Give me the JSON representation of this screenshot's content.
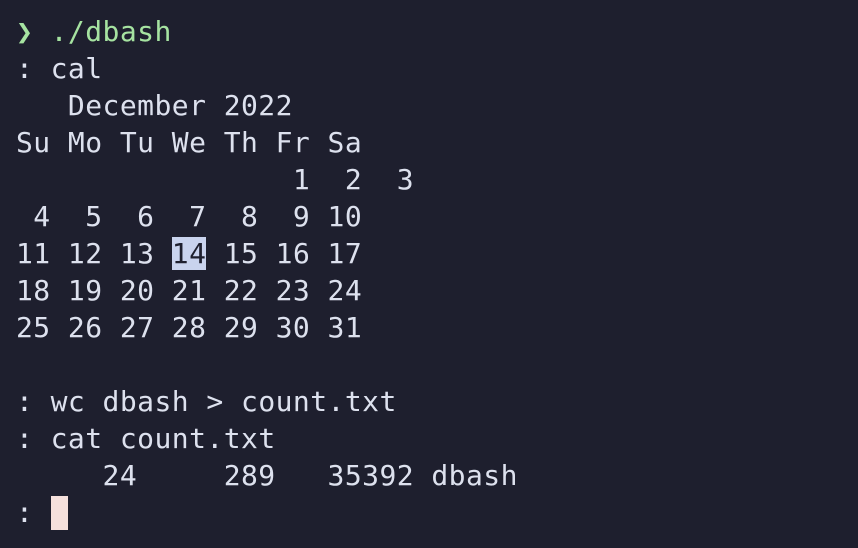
{
  "terminal": {
    "launch": {
      "arrow": "❯",
      "command": "./dbash"
    },
    "prompt_char": ":",
    "commands": {
      "cal": "cal",
      "wc": "wc dbash > count.txt",
      "cat": "cat count.txt"
    },
    "calendar": {
      "title_line": "   December 2022",
      "header_line": "Su Mo Tu We Th Fr Sa",
      "weeks": [
        "                1  2  3",
        " 4  5  6  7  8  9 10",
        {
          "before": "11 12 13 ",
          "today": "14",
          "after": " 15 16 17"
        },
        "18 19 20 21 22 23 24",
        "25 26 27 28 29 30 31"
      ]
    },
    "wc_output": "     24     289   35392 dbash",
    "colors": {
      "background": "#1e1f2e",
      "foreground": "#dde1ee",
      "prompt_green": "#a6e3a1",
      "today_highlight": "#c9d3ee",
      "cursor": "#f5e0dc"
    }
  }
}
